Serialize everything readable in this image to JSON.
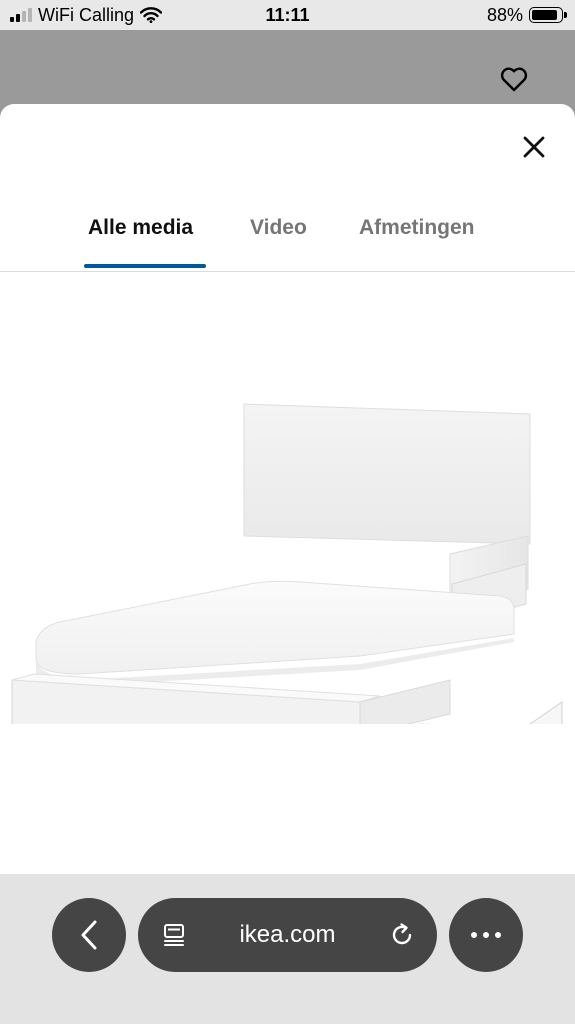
{
  "status_bar": {
    "carrier": "WiFi Calling",
    "time": "11:11",
    "battery_percent": "88%",
    "battery_level": 0.88,
    "signal_bars_active": 2,
    "signal_bars_total": 4
  },
  "header": {
    "favorite_icon": "heart-outline-icon"
  },
  "modal": {
    "close_icon": "close-icon",
    "tabs": [
      {
        "label": "Alle media",
        "active": true
      },
      {
        "label": "Video",
        "active": false
      },
      {
        "label": "Afmetingen",
        "active": false
      }
    ],
    "accent_color": "#0058a3",
    "image": "white-bed-frame-with-storage-drawers"
  },
  "browser": {
    "back_icon": "chevron-left-icon",
    "tabs_icon": "tab-overview-icon",
    "url": "ikea.com",
    "reload_icon": "reload-icon",
    "more_icon": "more-dots-icon"
  }
}
